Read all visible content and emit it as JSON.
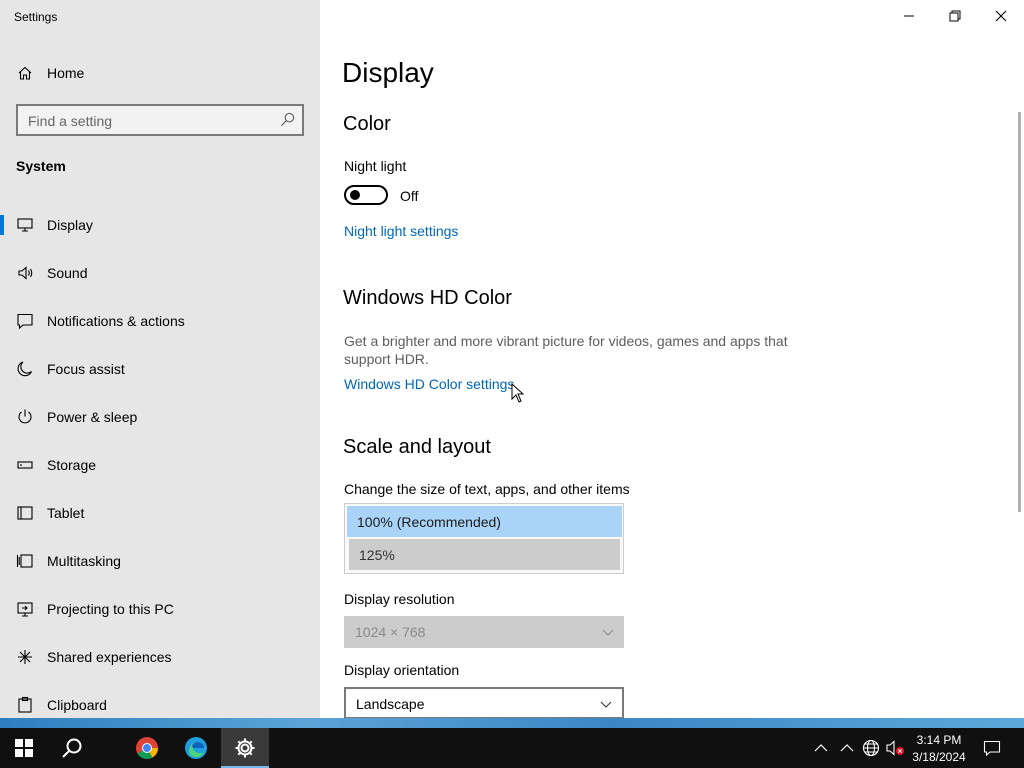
{
  "window": {
    "title": "Settings",
    "controls": {
      "minimize": "minimize",
      "restore": "restore",
      "close": "close"
    }
  },
  "sidebar": {
    "home_label": "Home",
    "search_placeholder": "Find a setting",
    "section_label": "System",
    "items": [
      {
        "label": "Display",
        "icon": "monitor-icon",
        "active": true
      },
      {
        "label": "Sound",
        "icon": "speaker-icon"
      },
      {
        "label": "Notifications & actions",
        "icon": "notification-icon"
      },
      {
        "label": "Focus assist",
        "icon": "moon-icon"
      },
      {
        "label": "Power & sleep",
        "icon": "power-icon"
      },
      {
        "label": "Storage",
        "icon": "storage-icon"
      },
      {
        "label": "Tablet",
        "icon": "tablet-icon"
      },
      {
        "label": "Multitasking",
        "icon": "multitasking-icon"
      },
      {
        "label": "Projecting to this PC",
        "icon": "projecting-icon"
      },
      {
        "label": "Shared experiences",
        "icon": "shared-icon"
      },
      {
        "label": "Clipboard",
        "icon": "clipboard-icon"
      }
    ]
  },
  "main": {
    "page_title": "Display",
    "color": {
      "heading": "Color",
      "night_light_label": "Night light",
      "night_light_state": "Off",
      "night_light_link": "Night light settings"
    },
    "hdr": {
      "heading": "Windows HD Color",
      "description": "Get a brighter and more vibrant picture for videos, games and apps that support HDR.",
      "link": "Windows HD Color settings"
    },
    "scale": {
      "heading": "Scale and layout",
      "change_size_label": "Change the size of text, apps, and other items",
      "options": [
        "100% (Recommended)",
        "125%"
      ],
      "selected": "100% (Recommended)",
      "resolution_label": "Display resolution",
      "resolution_value": "1024 × 768",
      "orientation_label": "Display orientation",
      "orientation_value": "Landscape"
    }
  },
  "taskbar": {
    "apps": [
      "start-icon",
      "search-icon",
      "chrome-icon",
      "edge-icon",
      "settings-icon"
    ],
    "active_app": "settings-icon",
    "time": "3:14 PM",
    "date": "3/18/2024"
  },
  "colors": {
    "accent": "#0078d7",
    "link": "#0067b8",
    "sidebar_bg": "#e6e6e6",
    "selected_option": "#a9d4f7",
    "taskbar_bg": "#101010"
  }
}
